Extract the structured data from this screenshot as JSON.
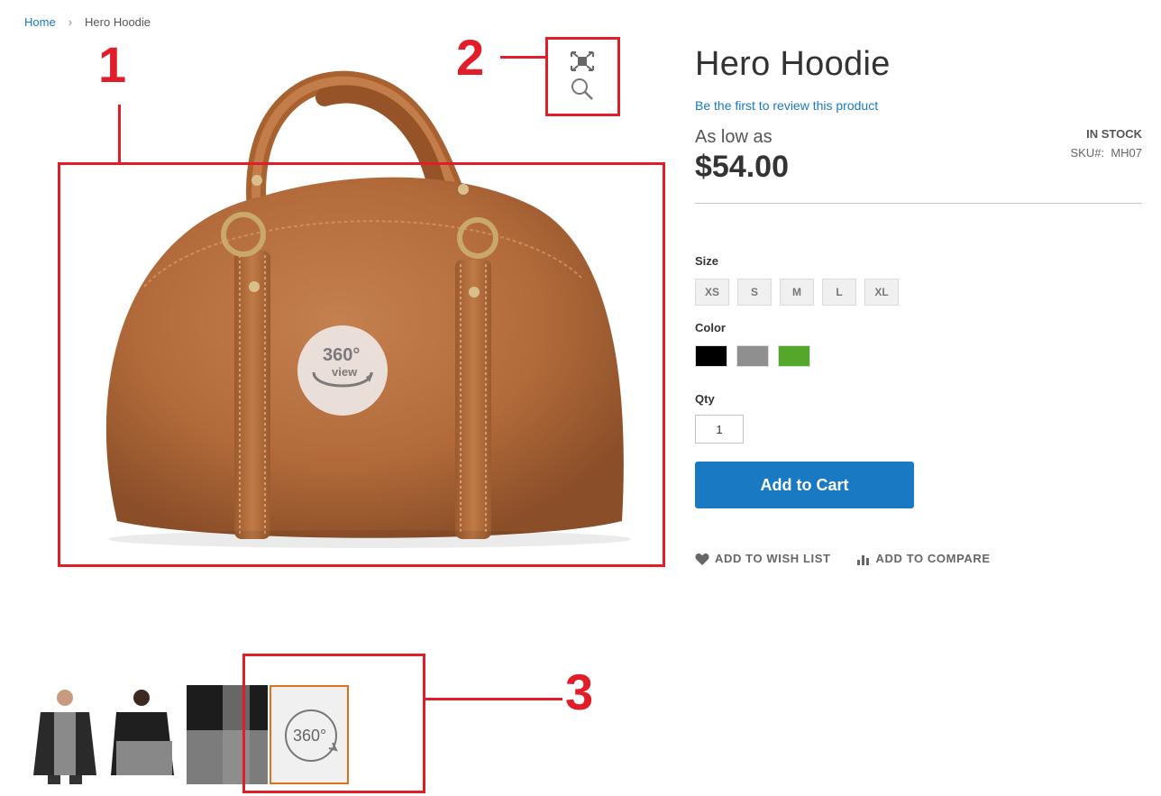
{
  "breadcrumb": {
    "home": "Home",
    "current": "Hero Hoodie"
  },
  "product": {
    "title": "Hero Hoodie",
    "review_link": "Be the first to review this product",
    "price_label": "As low as",
    "price": "$54.00",
    "stock": "IN STOCK",
    "sku_label": "SKU#:",
    "sku": "MH07"
  },
  "options": {
    "size_label": "Size",
    "sizes": [
      "XS",
      "S",
      "M",
      "L",
      "XL"
    ],
    "color_label": "Color",
    "colors": [
      "#000000",
      "#8f8f8f",
      "#53a72a"
    ],
    "qty_label": "Qty",
    "qty_value": "1"
  },
  "cart": {
    "add_label": "Add to Cart"
  },
  "actions": {
    "wishlist": "ADD TO WISH LIST",
    "compare": "ADD TO COMPARE"
  },
  "gallery": {
    "badge_360": "360°",
    "badge_view": "view",
    "thumb_360": "360°"
  },
  "annotations": [
    "1",
    "2",
    "3"
  ],
  "colors": {
    "accent": "#1979c3",
    "annotation": "#e11d2a",
    "active_thumb": "#e0701c"
  }
}
